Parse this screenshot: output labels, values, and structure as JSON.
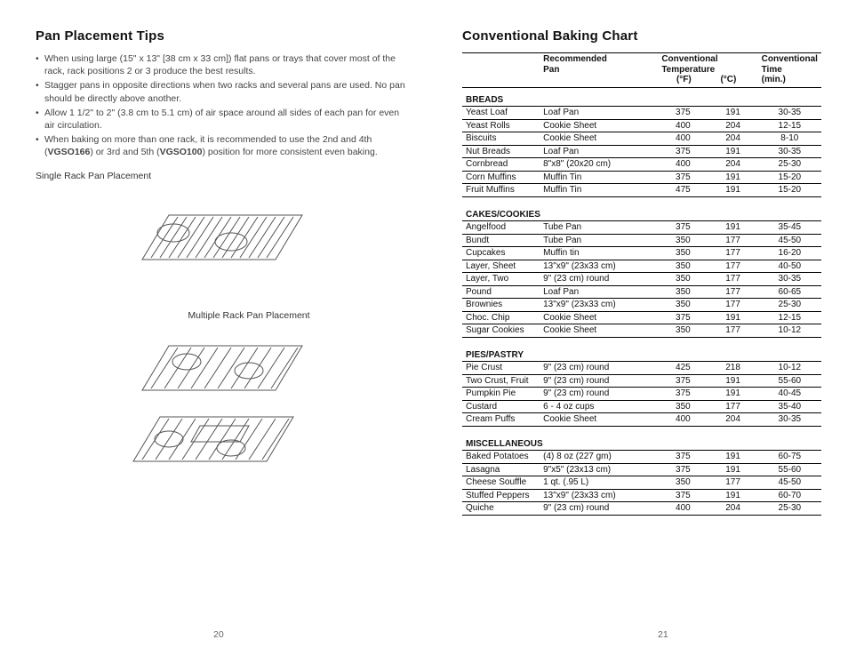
{
  "left": {
    "heading": "Pan Placement Tips",
    "tips": [
      "When using large (15\" x 13\" [38 cm x 33 cm]) flat pans or trays that cover most of the rack, rack positions 2 or 3 produce the best results.",
      "Stagger pans in opposite directions when two racks and several pans are used.  No pan should be directly above another.",
      "Allow 1 1/2\" to 2\" (3.8 cm to 5.1 cm) of air space around all sides of each pan for even air circulation.",
      "When baking on more than one rack, it is recommended to use the 2nd and 4th (VGSO166) or 3rd and 5th (VGSO100) position for more consistent even baking."
    ],
    "label_single": "Single Rack Pan Placement",
    "label_multiple": "Multiple Rack Pan Placement",
    "page_no": "20"
  },
  "right": {
    "heading": "Conventional Baking Chart",
    "header": {
      "pan1": "Recommended",
      "pan2": "Pan",
      "temp1": "Conventional",
      "temp2": "Temperature",
      "tf": "(°F)",
      "tc": "(°C)",
      "time1": "Conventional",
      "time2": "Time",
      "time3": "(min.)"
    },
    "page_no": "21"
  },
  "chart_data": {
    "type": "table",
    "groups": [
      {
        "name": "BREADS",
        "rows": [
          {
            "item": "Yeast Loaf",
            "pan": "Loaf Pan",
            "f": 375,
            "c": 191,
            "time": "30-35"
          },
          {
            "item": "Yeast Rolls",
            "pan": "Cookie Sheet",
            "f": 400,
            "c": 204,
            "time": "12-15"
          },
          {
            "item": "Biscuits",
            "pan": "Cookie Sheet",
            "f": 400,
            "c": 204,
            "time": "8-10"
          },
          {
            "item": "Nut Breads",
            "pan": "Loaf Pan",
            "f": 375,
            "c": 191,
            "time": "30-35"
          },
          {
            "item": "Cornbread",
            "pan": "8\"x8\" (20x20 cm)",
            "f": 400,
            "c": 204,
            "time": "25-30"
          },
          {
            "item": "Corn Muffins",
            "pan": "Muffin Tin",
            "f": 375,
            "c": 191,
            "time": "15-20"
          },
          {
            "item": "Fruit Muffins",
            "pan": "Muffin Tin",
            "f": 475,
            "c": 191,
            "time": "15-20"
          }
        ]
      },
      {
        "name": "CAKES/COOKIES",
        "rows": [
          {
            "item": "Angelfood",
            "pan": "Tube Pan",
            "f": 375,
            "c": 191,
            "time": "35-45"
          },
          {
            "item": "Bundt",
            "pan": "Tube Pan",
            "f": 350,
            "c": 177,
            "time": "45-50"
          },
          {
            "item": "Cupcakes",
            "pan": "Muffin tin",
            "f": 350,
            "c": 177,
            "time": "16-20"
          },
          {
            "item": "Layer, Sheet",
            "pan": "13\"x9\" (23x33 cm)",
            "f": 350,
            "c": 177,
            "time": "40-50"
          },
          {
            "item": "Layer, Two",
            "pan": "9\" (23 cm) round",
            "f": 350,
            "c": 177,
            "time": "30-35"
          },
          {
            "item": "Pound",
            "pan": "Loaf Pan",
            "f": 350,
            "c": 177,
            "time": "60-65"
          },
          {
            "item": "Brownies",
            "pan": "13\"x9\" (23x33 cm)",
            "f": 350,
            "c": 177,
            "time": "25-30"
          },
          {
            "item": "Choc. Chip",
            "pan": "Cookie Sheet",
            "f": 375,
            "c": 191,
            "time": "12-15"
          },
          {
            "item": "Sugar Cookies",
            "pan": "Cookie Sheet",
            "f": 350,
            "c": 177,
            "time": "10-12"
          }
        ]
      },
      {
        "name": "PIES/PASTRY",
        "rows": [
          {
            "item": "Pie Crust",
            "pan": "9\" (23 cm) round",
            "f": 425,
            "c": 218,
            "time": "10-12"
          },
          {
            "item": "Two Crust, Fruit",
            "pan": "9\" (23 cm) round",
            "f": 375,
            "c": 191,
            "time": "55-60"
          },
          {
            "item": "Pumpkin Pie",
            "pan": "9\" (23 cm) round",
            "f": 375,
            "c": 191,
            "time": "40-45"
          },
          {
            "item": "Custard",
            "pan": "6 - 4 oz cups",
            "f": 350,
            "c": 177,
            "time": "35-40"
          },
          {
            "item": "Cream Puffs",
            "pan": "Cookie Sheet",
            "f": 400,
            "c": 204,
            "time": "30-35"
          }
        ]
      },
      {
        "name": "MISCELLANEOUS",
        "rows": [
          {
            "item": "Baked Potatoes",
            "pan": "(4) 8 oz (227 gm)",
            "f": 375,
            "c": 191,
            "time": "60-75"
          },
          {
            "item": "Lasagna",
            "pan": "9\"x5\" (23x13 cm)",
            "f": 375,
            "c": 191,
            "time": "55-60"
          },
          {
            "item": "Cheese Souffle",
            "pan": "1 qt. (.95 L)",
            "f": 350,
            "c": 177,
            "time": "45-50"
          },
          {
            "item": "Stuffed Peppers",
            "pan": "13\"x9\" (23x33 cm)",
            "f": 375,
            "c": 191,
            "time": "60-70"
          },
          {
            "item": "Quiche",
            "pan": "9\" (23 cm) round",
            "f": 400,
            "c": 204,
            "time": "25-30"
          }
        ]
      }
    ]
  }
}
